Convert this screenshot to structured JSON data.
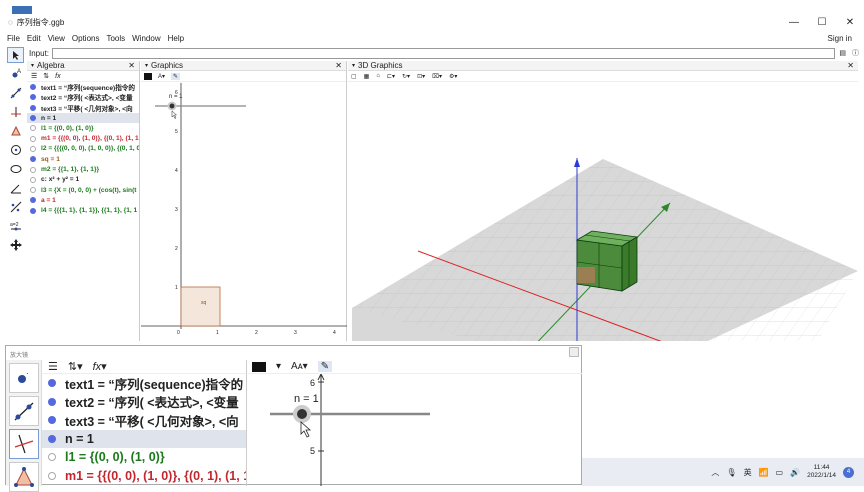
{
  "window": {
    "title": "序列指令.ggb",
    "controls": [
      "—",
      "☐",
      "✕"
    ]
  },
  "menu": {
    "items": [
      "File",
      "Edit",
      "View",
      "Options",
      "Tools",
      "Window",
      "Help"
    ],
    "sign_in": "Sign in"
  },
  "input_bar": {
    "label": "Input:",
    "value": ""
  },
  "algebra": {
    "title": "Algebra",
    "rows": [
      {
        "text": "text1 = “序列(sequence)指令的",
        "color": "#222222",
        "dot": "on"
      },
      {
        "text": "text2 = “序列( <表达式>, <变量",
        "color": "#222222",
        "dot": "on"
      },
      {
        "text": "text3 = “平移( <几何对象>, <向",
        "color": "#222222",
        "dot": "on"
      },
      {
        "text": "n = 1",
        "color": "#222222",
        "dot": "on",
        "selected": true
      },
      {
        "text": "l1 = {(0, 0), (1, 0)}",
        "color": "#1b7a1b",
        "dot": "off"
      },
      {
        "text": "m1 = {{(0, 0), (1, 0)}, {(0, 1), (1, 1",
        "color": "#c1272d",
        "dot": "off"
      },
      {
        "text": "l2 = {{{(0, 0, 0), (1, 0, 0)}, {(0, 1, 0",
        "color": "#1b7a1b",
        "dot": "off"
      },
      {
        "text": "sq = 1",
        "color": "#9c5a1a",
        "dot": "on"
      },
      {
        "text": "m2 = {{1, 1}, {1, 1}}",
        "color": "#1b7a1b",
        "dot": "off"
      },
      {
        "text": "c: x² + y² = 1",
        "color": "#222222",
        "dot": "off"
      },
      {
        "text": "l3 = {X = (0, 0, 0) + (cos(t), sin(t",
        "color": "#1b7a1b",
        "dot": "off"
      },
      {
        "text": "a = 1",
        "color": "#c1272d",
        "dot": "on"
      },
      {
        "text": "l4 = {{{1, 1}, {1, 1}}, {{1, 1}, {1, 1",
        "color": "#1b7a1b",
        "dot": "on"
      }
    ]
  },
  "graphics": {
    "title": "Graphics",
    "slider_label": "n = 1",
    "square_label": "sq",
    "x_ticks": [
      "0",
      "1",
      "2",
      "3",
      "4"
    ],
    "y_ticks": [
      "1",
      "2",
      "3",
      "4",
      "5",
      "6"
    ]
  },
  "graphics3d": {
    "title": "3D Graphics"
  },
  "zoom_window": {
    "title": "放大镜",
    "rows": [
      {
        "text": "text1 = “序列(sequence)指令的",
        "color": "#222222",
        "dot": "on"
      },
      {
        "text": "text2 = “序列( <表达式>, <变量",
        "color": "#222222",
        "dot": "on"
      },
      {
        "text": "text3 = “平移( <几何对象>, <向",
        "color": "#222222",
        "dot": "on"
      },
      {
        "text": "n = 1",
        "color": "#222222",
        "dot": "on",
        "selected": true
      },
      {
        "text": "l1 = {(0, 0), (1, 0)}",
        "color": "#1b7a1b",
        "dot": "off"
      },
      {
        "text": "m1 = {{(0, 0), (1, 0)}, {(0, 1), (1, 1",
        "color": "#c1272d",
        "dot": "off"
      }
    ],
    "slider_label": "n = 1",
    "y_ticks": [
      "6",
      "5"
    ]
  },
  "taskbar": {
    "ime": "英",
    "time": "11:44",
    "date": "2022/1/14",
    "notif": "4"
  },
  "colors": {
    "accent": "#5568dd",
    "green": "#1b7a1b",
    "red": "#c1272d"
  }
}
